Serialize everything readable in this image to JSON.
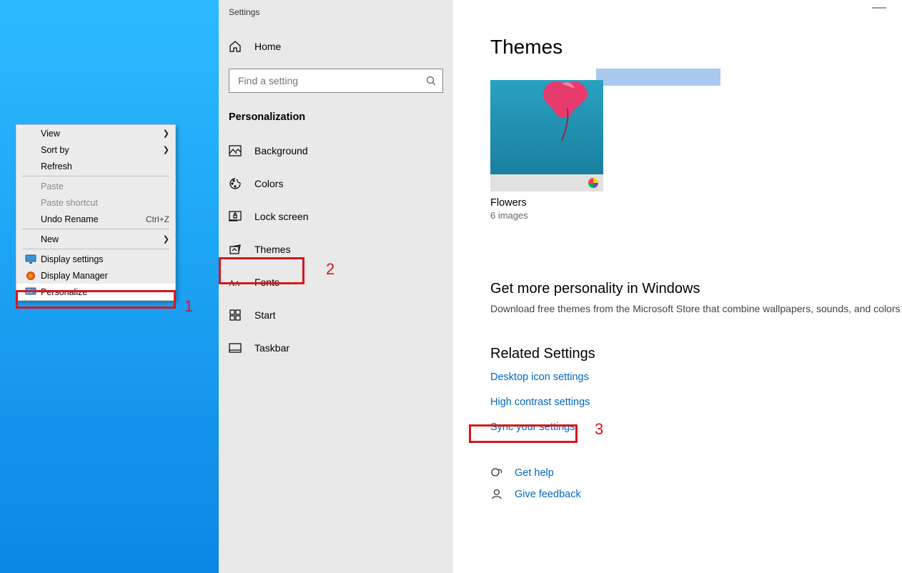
{
  "context_menu": {
    "items": [
      {
        "label": "View",
        "submenu": true
      },
      {
        "label": "Sort by",
        "submenu": true
      },
      {
        "label": "Refresh"
      },
      {
        "sep": true
      },
      {
        "label": "Paste",
        "disabled": true
      },
      {
        "label": "Paste shortcut",
        "disabled": true
      },
      {
        "label": "Undo Rename",
        "shortcut": "Ctrl+Z"
      },
      {
        "sep": true
      },
      {
        "label": "New",
        "submenu": true
      },
      {
        "sep": true
      },
      {
        "label": "Display settings",
        "icon": "monitor"
      },
      {
        "label": "Display Manager",
        "icon": "orb"
      },
      {
        "label": "Personalize",
        "icon": "personalize"
      }
    ]
  },
  "annotations": {
    "n1": "1",
    "n2": "2",
    "n3": "3"
  },
  "settings": {
    "window_title": "Settings",
    "home_label": "Home",
    "search_placeholder": "Find a setting",
    "section": "Personalization",
    "nav": [
      {
        "id": "background",
        "label": "Background"
      },
      {
        "id": "colors",
        "label": "Colors"
      },
      {
        "id": "lockscreen",
        "label": "Lock screen"
      },
      {
        "id": "themes",
        "label": "Themes"
      },
      {
        "id": "fonts",
        "label": "Fonts"
      },
      {
        "id": "start",
        "label": "Start"
      },
      {
        "id": "taskbar",
        "label": "Taskbar"
      }
    ]
  },
  "main": {
    "title": "Themes",
    "theme": {
      "name": "Flowers",
      "subtitle": "6 images"
    },
    "more_heading": "Get more personality in Windows",
    "more_text": "Download free themes from the Microsoft Store that combine wallpapers, sounds, and colors",
    "related_heading": "Related Settings",
    "links": {
      "desktop_icon": "Desktop icon settings",
      "high_contrast": "High contrast settings",
      "sync": "Sync your settings"
    },
    "help": "Get help",
    "feedback": "Give feedback"
  }
}
